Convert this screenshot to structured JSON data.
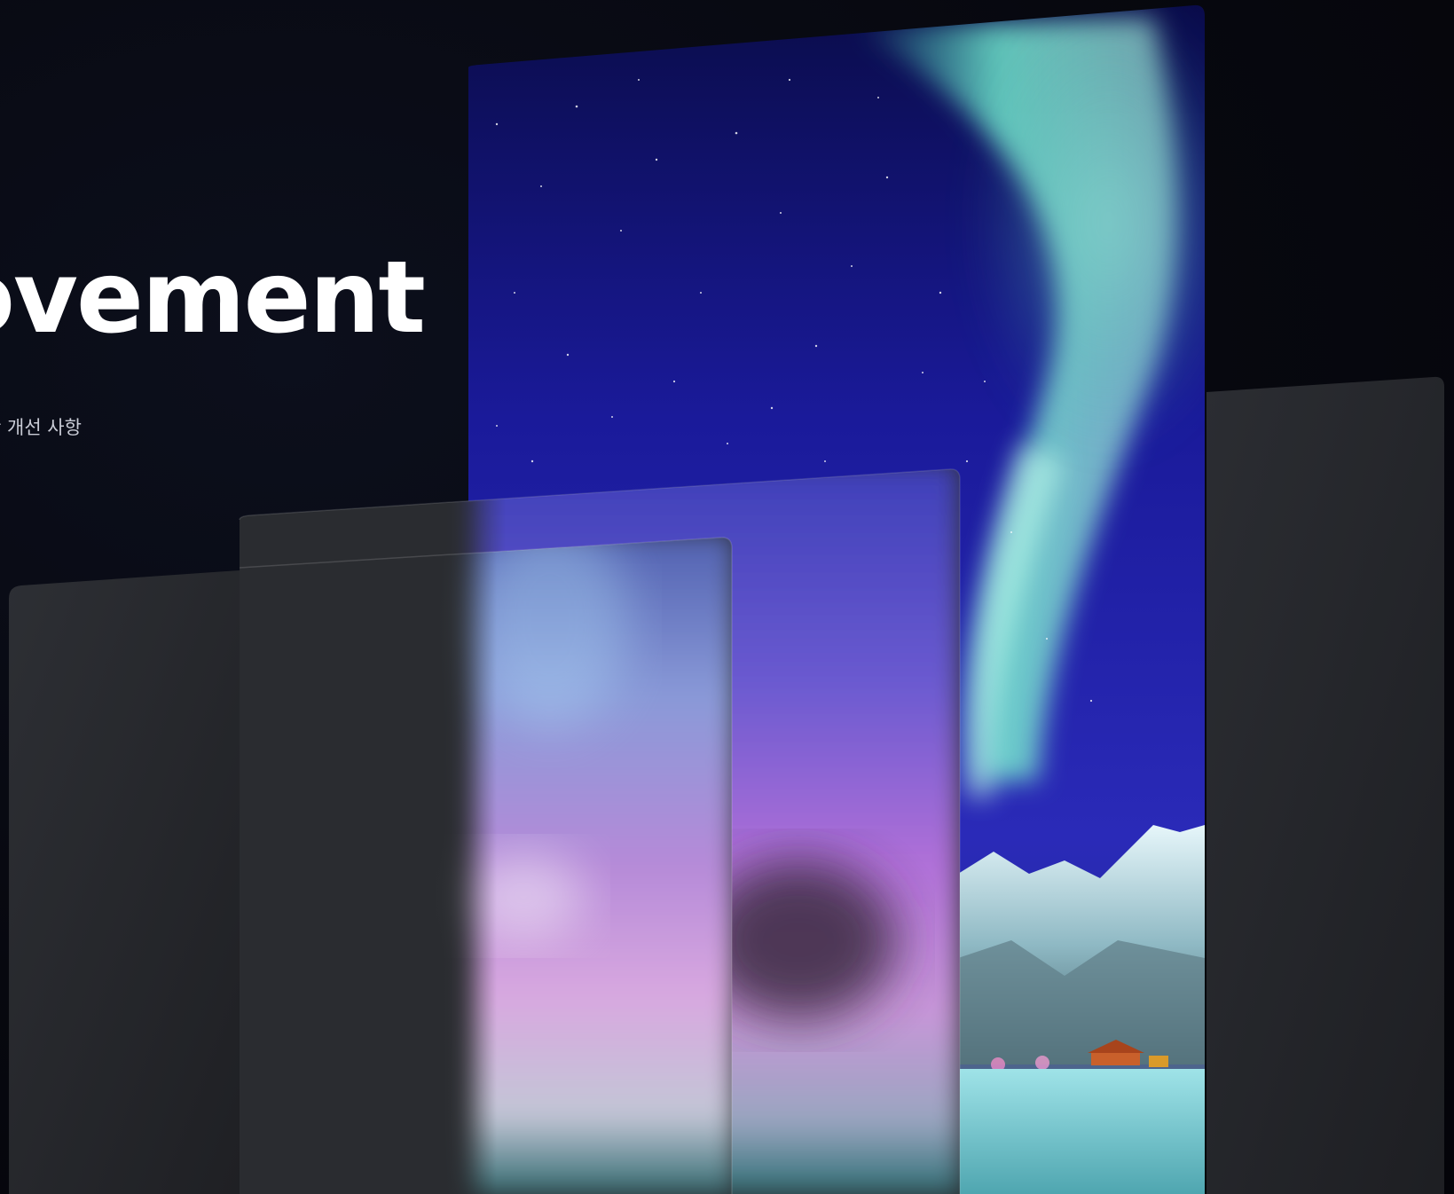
{
  "hero": {
    "title": "ovement",
    "subtitle": "안 개선 사항"
  },
  "colors": {
    "background": "#06070d",
    "title": "#ffffff",
    "subtitle": "#c9ccd6",
    "panel_dark": "#2b2d31",
    "sky_deep": "#10127a",
    "aurora_green": "#5fe0c0",
    "aurora_purple": "#c060d0",
    "snow": "#bfe6ec"
  },
  "panels": [
    {
      "name": "far-right-gray-panel",
      "style": "dark-glass"
    },
    {
      "name": "tall-aurora-panel",
      "style": "aurora-photo"
    },
    {
      "name": "middle-frosted-panel",
      "style": "frosted-glass"
    },
    {
      "name": "front-frosted-panel",
      "style": "frosted-glass"
    },
    {
      "name": "left-gray-panel",
      "style": "dark-glass"
    }
  ]
}
